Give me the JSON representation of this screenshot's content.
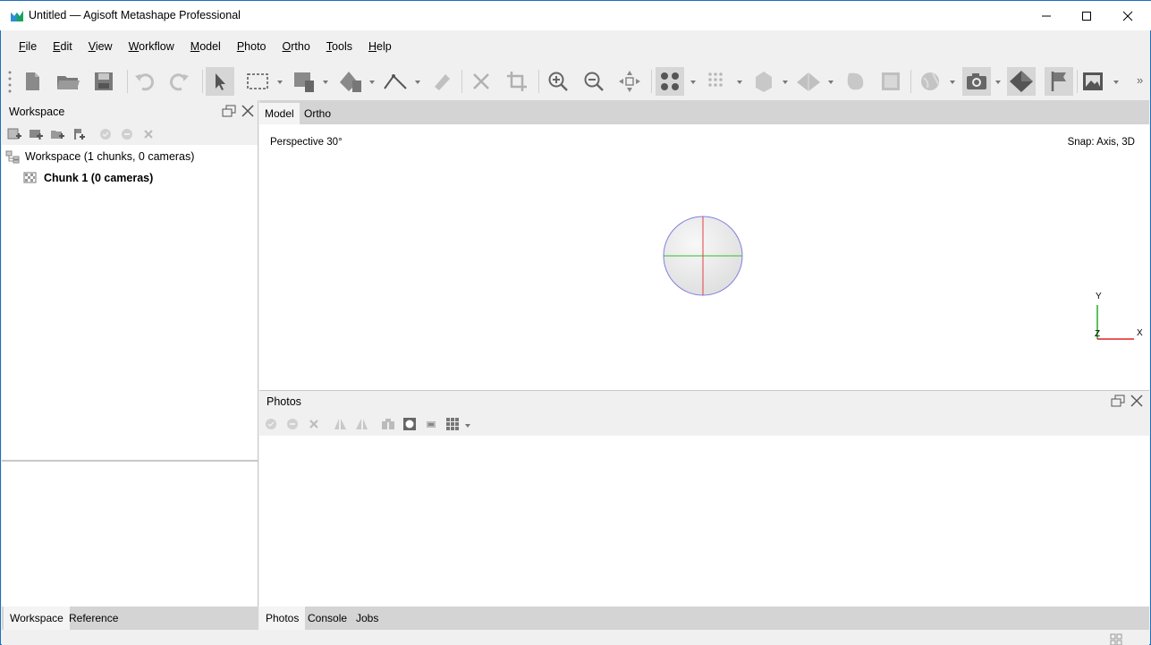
{
  "window": {
    "title": "Untitled — Agisoft Metashape Professional",
    "accent_color": "#1f6fbf",
    "controls": [
      "minimize-icon",
      "maximize-icon",
      "close-icon"
    ]
  },
  "menu": {
    "items": [
      {
        "label": "File",
        "mnemonic": "F"
      },
      {
        "label": "Edit",
        "mnemonic": "E"
      },
      {
        "label": "View",
        "mnemonic": "V"
      },
      {
        "label": "Workflow",
        "mnemonic": "W"
      },
      {
        "label": "Model",
        "mnemonic": "M"
      },
      {
        "label": "Photo",
        "mnemonic": "P"
      },
      {
        "label": "Ortho",
        "mnemonic": "O"
      },
      {
        "label": "Tools",
        "mnemonic": "T"
      },
      {
        "label": "Help",
        "mnemonic": "H"
      }
    ]
  },
  "toolbar": {
    "icons": [
      "new-icon",
      "open-icon",
      "save-icon",
      "undo-icon",
      "redo-icon",
      "navigation-icon",
      "rectangle-selection-icon",
      "draw-polygon-icon",
      "shape-tool-icon",
      "ruler-icon",
      "marker-icon",
      "delete-icon",
      "crop-icon",
      "zoom-in-icon",
      "zoom-out-icon",
      "reset-view-icon",
      "show-points-icon",
      "show-dense-cloud-icon",
      "show-tiled-icon",
      "show-model-icon",
      "show-texture-icon",
      "show-dem-icon",
      "show-cameras-icon",
      "show-region-icon",
      "show-shapes-icon",
      "show-markers-icon",
      "show-images-icon"
    ],
    "overflow": "»"
  },
  "workspace": {
    "title": "Workspace",
    "tree": {
      "root_label": "Workspace (1 chunks, 0 cameras)",
      "chunk_label": "Chunk 1 (0 cameras)"
    },
    "tabs": [
      "Workspace",
      "Reference"
    ]
  },
  "model_view": {
    "tabs": [
      "Model",
      "Ortho"
    ],
    "projection_label": "Perspective 30°",
    "snap_label": "Snap: Axis, 3D",
    "axes": {
      "x": "X",
      "y": "Y",
      "z": "Z"
    },
    "colors": {
      "x_axis": "#e02020",
      "y_axis": "#20b020",
      "z_axis": "#2020e0"
    }
  },
  "photos": {
    "title": "Photos",
    "tabs": [
      "Photos",
      "Console",
      "Jobs"
    ]
  }
}
